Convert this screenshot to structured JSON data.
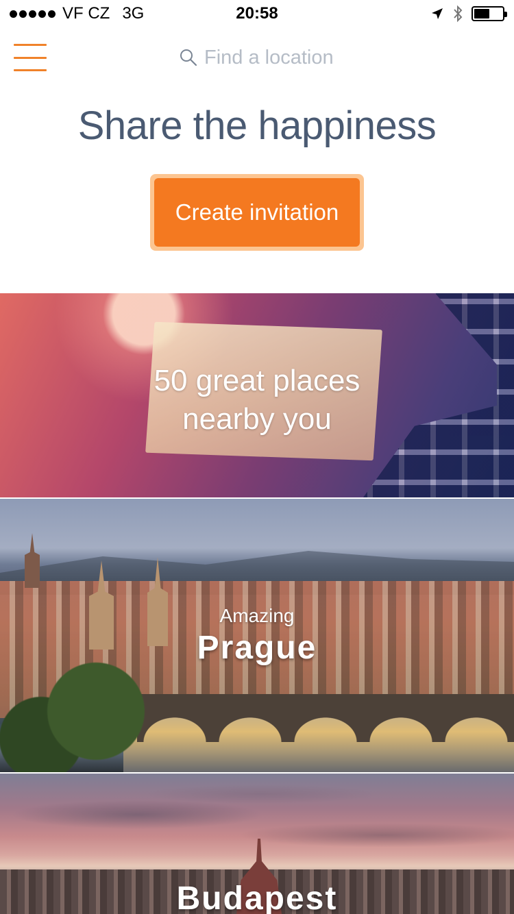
{
  "status_bar": {
    "carrier": "VF CZ",
    "network": "3G",
    "time": "20:58",
    "signal_bars": 5,
    "battery_level_fraction": 0.55
  },
  "nav": {
    "menu_icon": "hamburger-menu-icon",
    "search": {
      "icon": "search-icon",
      "placeholder": "Find a location",
      "value": ""
    }
  },
  "hero": {
    "headline": "Share the happiness",
    "cta_label": "Create invitation"
  },
  "cards": [
    {
      "kind": "collection",
      "line1": "50 great places",
      "line2": "nearby you"
    },
    {
      "kind": "city",
      "subtitle": "Amazing",
      "title": "Prague"
    },
    {
      "kind": "city",
      "subtitle": "",
      "title": "Budapest"
    }
  ],
  "colors": {
    "accent": "#f47920",
    "accent_border": "#fcc591",
    "headline": "#4a5a72",
    "placeholder": "#b5bcc6"
  }
}
